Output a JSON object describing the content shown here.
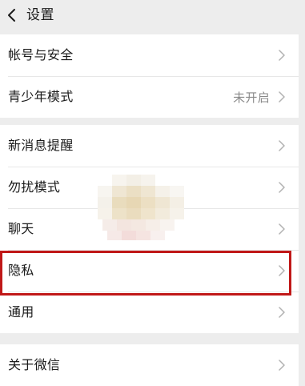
{
  "header": {
    "title": "设置",
    "back_icon": "chevron-left-icon"
  },
  "groups": [
    {
      "items": [
        {
          "label": "帐号与安全",
          "value": ""
        },
        {
          "label": "青少年模式",
          "value": "未开启"
        }
      ]
    },
    {
      "items": [
        {
          "label": "新消息提醒",
          "value": ""
        },
        {
          "label": "勿扰模式",
          "value": ""
        },
        {
          "label": "聊天",
          "value": ""
        },
        {
          "label": "隐私",
          "value": ""
        },
        {
          "label": "通用",
          "value": ""
        }
      ]
    },
    {
      "items": [
        {
          "label": "关于微信",
          "value": ""
        }
      ]
    }
  ],
  "colors": {
    "background": "#ededed",
    "card": "#ffffff",
    "highlight": "#c01818",
    "chevron": "#b2b2b2"
  }
}
